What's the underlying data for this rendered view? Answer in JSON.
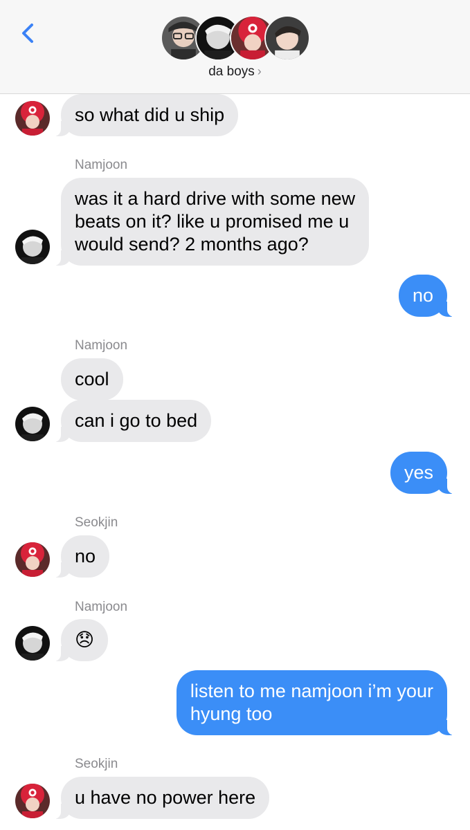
{
  "header": {
    "group_name": "da boys",
    "chevron": "›",
    "back_icon": "chevron-left-icon",
    "accent": "#3b82f6"
  },
  "colors": {
    "incoming_bubble": "#e9e9eb",
    "outgoing_bubble": "#3b8ef7",
    "sender_label": "#8a8a8e"
  },
  "messages": [
    {
      "direction": "in",
      "sender": "",
      "text": "so what did u ship",
      "avatar": "seokjin-avatar"
    },
    {
      "direction": "in",
      "sender": "Namjoon",
      "text_lines": [
        "was it a hard drive with some new",
        "beats on it? like u promised me u",
        "would send? 2 months ago?"
      ],
      "avatar": "namjoon-avatar"
    },
    {
      "direction": "out",
      "text": "no"
    },
    {
      "direction": "in",
      "sender": "Namjoon",
      "text": "cool"
    },
    {
      "direction": "in",
      "text": "can i go to bed",
      "avatar": "namjoon-avatar"
    },
    {
      "direction": "out",
      "text": "yes"
    },
    {
      "direction": "in",
      "sender": "Seokjin",
      "text": "no",
      "avatar": "seokjin-avatar"
    },
    {
      "direction": "in",
      "sender": "Namjoon",
      "text": "😞",
      "avatar": "namjoon-avatar"
    },
    {
      "direction": "out",
      "text_lines": [
        "listen to me namjoon i’m your",
        "hyung too"
      ]
    },
    {
      "direction": "in",
      "sender": "Seokjin",
      "text": "u have no power here",
      "avatar": "seokjin-avatar"
    }
  ]
}
